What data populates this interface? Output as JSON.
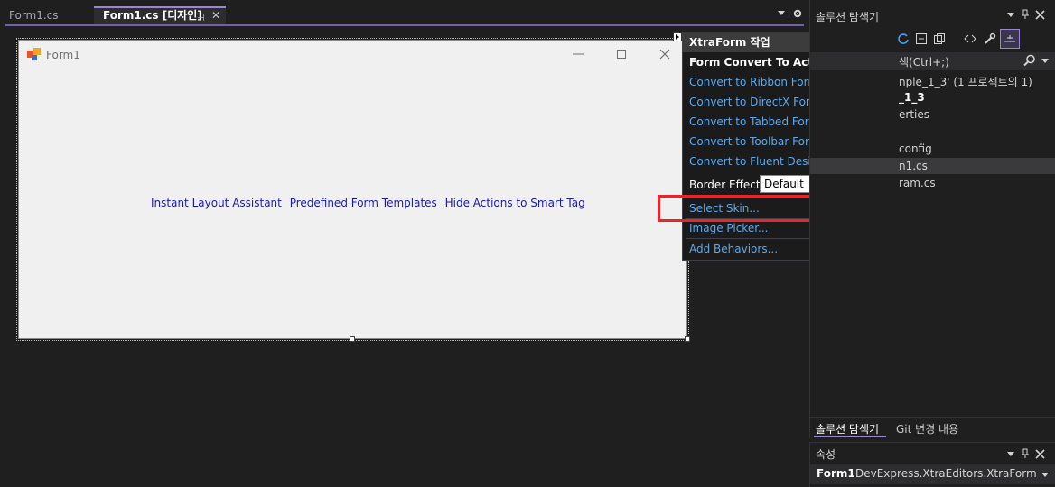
{
  "doc_tabs": [
    {
      "label": "Form1.cs",
      "active": false
    },
    {
      "label": "Form1.cs [디자인]",
      "active": true
    }
  ],
  "form": {
    "title": "Form1",
    "links": [
      "Instant Layout Assistant",
      "Predefined Form Templates",
      "Hide Actions to Smart Tag"
    ]
  },
  "actions": {
    "header": "XtraForm 작업",
    "section": "Form Convert To Actions",
    "convert_links": [
      "Convert to Ribbon Form",
      "Convert to DirectX Form",
      "Convert to Tabbed Form",
      "Convert to Toolbar Form",
      "Convert to Fluent Design Form"
    ],
    "border_effect_label": "Border Effect",
    "border_effect_value": "Default",
    "select_skin": "Select Skin...",
    "image_picker": "Image Picker...",
    "add_behaviors": "Add Behaviors..."
  },
  "solution_explorer": {
    "title": "솔루션 탐색기",
    "search_text": "색(Ctrl+;)",
    "items": [
      "nple_1_3'  (1 프로젝트의 1)",
      "_1_3",
      "erties",
      "config",
      "n1.cs",
      "ram.cs"
    ],
    "tabs": [
      "솔루션 탐색기",
      "Git 변경 내용"
    ]
  },
  "properties": {
    "title": "속성",
    "object_name": "Form1",
    "object_type": "DevExpress.XtraEditors.XtraForm"
  },
  "colors": {
    "accent": "#7160a8",
    "link_blue": "#1a1ab8",
    "action_link": "#5fa8e8",
    "highlight_red": "#e8242c"
  }
}
